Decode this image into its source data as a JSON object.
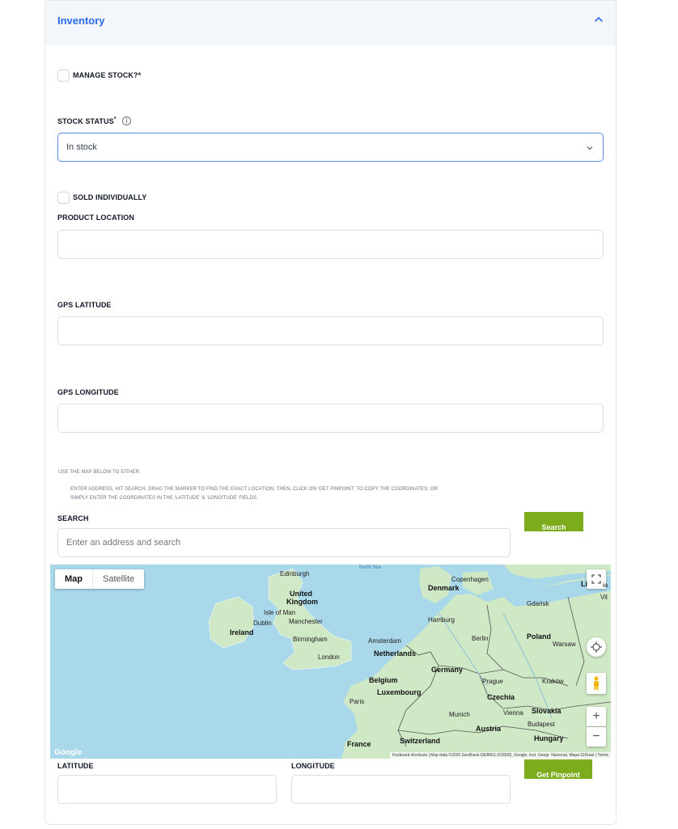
{
  "section": {
    "title": "Inventory"
  },
  "manage_stock": {
    "label": "MANAGE STOCK?",
    "required": "*"
  },
  "stock_status": {
    "label": "STOCK STATUS",
    "required": "*",
    "info": "i",
    "value": "In stock"
  },
  "sold_individually": {
    "label": "SOLD INDIVIDUALLY"
  },
  "product_location": {
    "label": "PRODUCT LOCATION",
    "value": ""
  },
  "gps_latitude": {
    "label": "GPS LATITUDE",
    "value": ""
  },
  "gps_longitude": {
    "label": "GPS LONGITUDE",
    "value": ""
  },
  "instructions": {
    "line1": "USE THE MAP BELOW TO EITHER:",
    "line2": "ENTER ADDRESS, HIT SEARCH, DRAG THE MARKER TO FIND THE EXACT LOCATION, THEN, CLICK ON 'GET PINPOINT' TO COPY THE COORDINATES; OR",
    "line3": "SIMPLY ENTER THE COORDINATES IN THE 'LATITUDE' & 'LONGITUDE' FIELDS."
  },
  "search": {
    "label": "SEARCH",
    "placeholder": "Enter an address and search",
    "button": "Search"
  },
  "map": {
    "type_map": "Map",
    "type_satellite": "Satellite",
    "zoom_in": "+",
    "zoom_out": "−",
    "google": "Google",
    "keyboard": "Keyboard shortcuts",
    "mapdata": "Map data ©2025 GeoBasis-DE/BKG (©2009), Google, Inst. Geogr. Nacional, Mapa GISrael",
    "terms": "Terms",
    "labels": {
      "north_sea": "North Sea",
      "edinburgh": "Edinburgh",
      "united": "United",
      "kingdom": "Kingdom",
      "isle_of_man": "Isle of Man",
      "dublin": "Dublin",
      "ireland": "Ireland",
      "manchester": "Manchester",
      "birmingham": "Birmingham",
      "london": "London",
      "denmark": "Denmark",
      "copenhagen": "Copenhagen",
      "gdansk": "Gdańsk",
      "hamburg": "Hamburg",
      "amsterdam": "Amsterdam",
      "netherlands": "Netherlands",
      "berlin": "Berlin",
      "poland": "Poland",
      "warsaw": "Warsaw",
      "germany": "Germany",
      "belgium": "Belgium",
      "luxembourg": "Luxembourg",
      "prague": "Prague",
      "krakow": "Kraków",
      "czechia": "Czechia",
      "paris": "Paris",
      "munich": "Munich",
      "vienna": "Vienna",
      "slovakia": "Slovakia",
      "budapest": "Budapest",
      "austria": "Austria",
      "hungary": "Hungary",
      "france": "France",
      "switzerland": "Switzerland",
      "li": "Li",
      "vil": "Vil",
      "lia": "ia"
    }
  },
  "latitude": {
    "label": "LATITUDE",
    "value": ""
  },
  "longitude": {
    "label": "LONGITUDE",
    "value": ""
  },
  "pinpoint": {
    "button": "Get Pinpoint"
  },
  "colors": {
    "accent": "#2b6ae8",
    "button_green": "#7cab1b",
    "sea": "#a8d8ea",
    "land": "#cfe8c5"
  }
}
